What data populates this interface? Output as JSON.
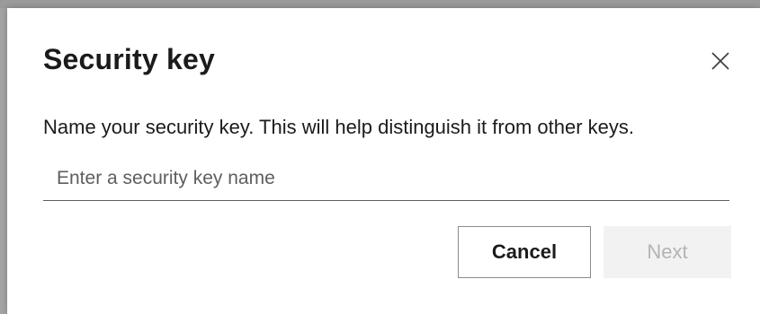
{
  "dialog": {
    "title": "Security key",
    "description": "Name your security key. This will help distinguish it from other keys.",
    "name_input": {
      "value": "",
      "placeholder": "Enter a security key name"
    },
    "buttons": {
      "cancel_label": "Cancel",
      "next_label": "Next",
      "next_disabled": true
    },
    "close_icon": "close-icon"
  }
}
